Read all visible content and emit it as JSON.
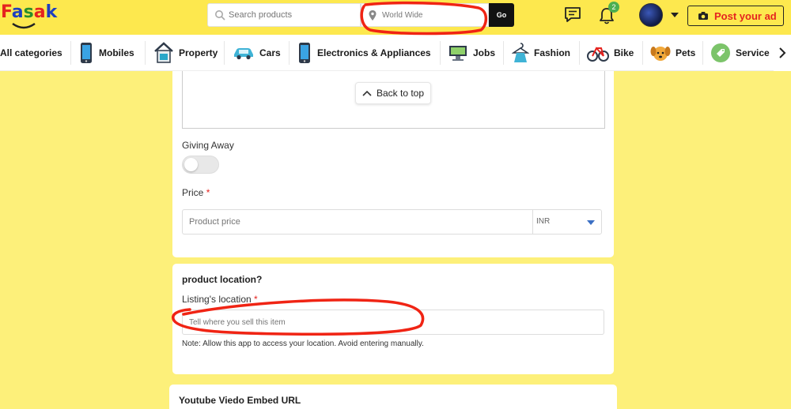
{
  "brand": {
    "logo_text": "Fasak"
  },
  "header": {
    "search_placeholder": "Search products",
    "location_value": "World Wide",
    "go_label": "Go",
    "notification_count": "2",
    "post_ad_label": "Post your ad"
  },
  "categories": [
    {
      "label": "All categories",
      "icon": "none"
    },
    {
      "label": "Mobiles",
      "icon": "mobile-icon"
    },
    {
      "label": "Property",
      "icon": "property-icon"
    },
    {
      "label": "Cars",
      "icon": "car-icon"
    },
    {
      "label": "Electronics & Appliances",
      "icon": "electronics-icon"
    },
    {
      "label": "Jobs",
      "icon": "jobs-icon"
    },
    {
      "label": "Fashion",
      "icon": "fashion-icon"
    },
    {
      "label": "Bike",
      "icon": "bike-icon"
    },
    {
      "label": "Pets",
      "icon": "pets-icon"
    },
    {
      "label": "Service",
      "icon": "service-icon"
    }
  ],
  "form": {
    "back_to_top_label": "Back to top",
    "giving_away_label": "Giving Away",
    "giving_away_on": false,
    "price_label": "Price",
    "required_mark": "*",
    "price_placeholder": "Product price",
    "currency_value": "INR",
    "location_section_title": "product location?",
    "listing_location_label": "Listing's location",
    "listing_location_placeholder": "Tell where you sell this item",
    "location_note": "Note: Allow this app to access your location. Avoid entering manually.",
    "youtube_section_title": "Youtube Viedo Embed URL"
  },
  "colors": {
    "header_bg": "#fde84e",
    "page_bg": "#fdf07a",
    "accent_red": "#e5231f",
    "annotation_red": "#f02414",
    "badge_green": "#4caf50"
  }
}
